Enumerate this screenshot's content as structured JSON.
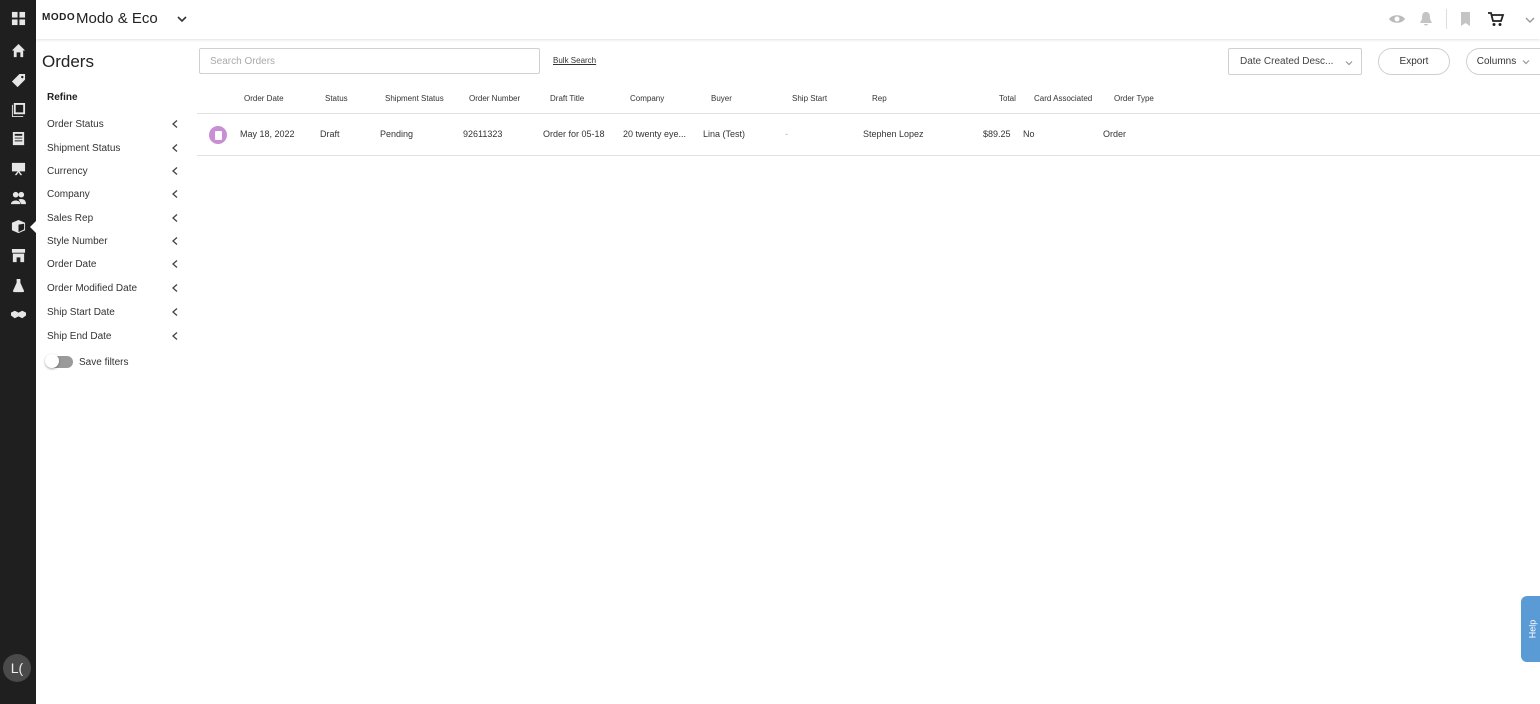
{
  "topbar": {
    "logo_text": "MODO",
    "brand_name": "Modo & Eco"
  },
  "rail": {
    "icons": [
      "dashboard-icon",
      "home-icon",
      "tag-icon",
      "catalog-icon",
      "book-icon",
      "presentation-icon",
      "customers-icon",
      "orders-icon",
      "store-icon",
      "ink-icon",
      "handshake-icon"
    ],
    "avatar_initials": "L("
  },
  "page": {
    "title": "Orders"
  },
  "refine": {
    "title": "Refine",
    "filters": [
      "Order Status",
      "Shipment Status",
      "Currency",
      "Company",
      "Sales Rep",
      "Style Number",
      "Order Date",
      "Order Modified Date",
      "Ship Start Date",
      "Ship End Date"
    ],
    "save_filters_label": "Save filters"
  },
  "toolbar": {
    "search_placeholder": "Search Orders",
    "bulk_search_label": "Bulk Search",
    "sort_value": "Date Created Desc...",
    "export_label": "Export",
    "columns_label": "Columns"
  },
  "table": {
    "headers": [
      "Order Date",
      "Status",
      "Shipment Status",
      "Order Number",
      "Draft Title",
      "Company",
      "Buyer",
      "Ship Start",
      "Rep",
      "Total",
      "Card Associated",
      "Order Type"
    ],
    "rows": [
      {
        "order_date": "May 18, 2022",
        "status": "Draft",
        "shipment_status": "Pending",
        "order_number": "92611323",
        "draft_title": "Order for 05-18",
        "company": "20 twenty eye...",
        "buyer": "Lina (Test)",
        "ship_start": "-",
        "rep": "Stephen Lopez",
        "total": "$89.25",
        "card_associated": "No",
        "order_type": "Order"
      }
    ]
  },
  "help": {
    "label": "Help"
  },
  "colors": {
    "rail_bg": "#1f1f1f",
    "draft_icon": "#c98fd6",
    "help_tab": "#5b9bd5"
  }
}
